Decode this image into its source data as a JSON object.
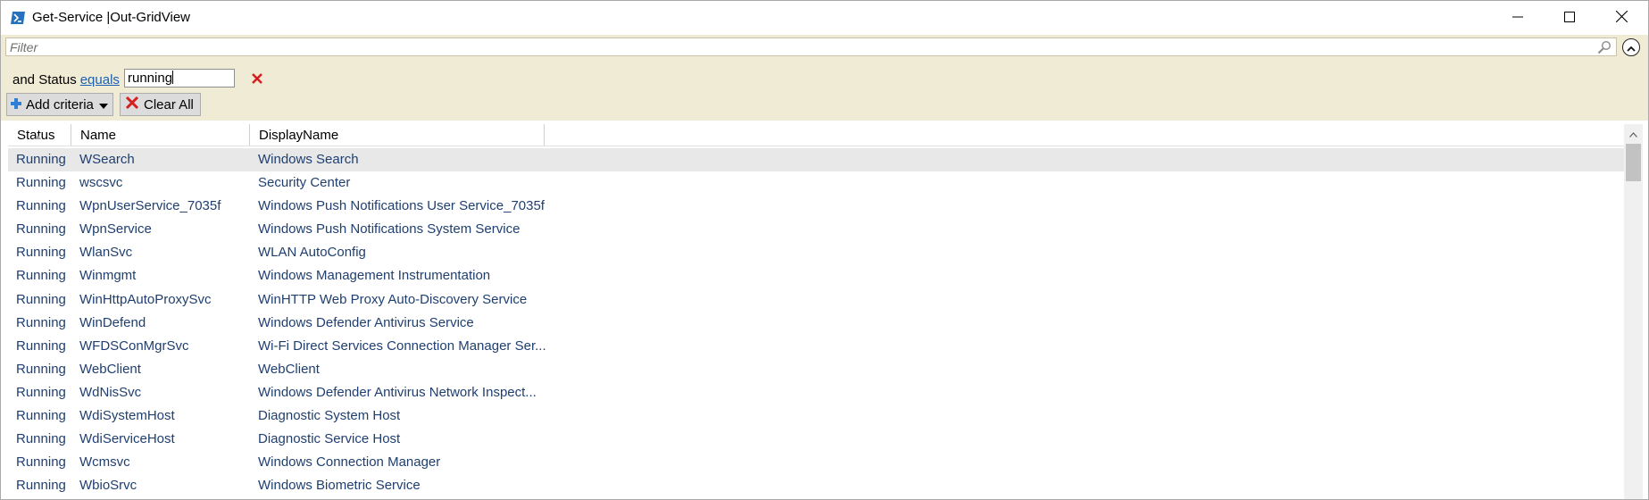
{
  "window": {
    "title": "Get-Service |Out-GridView",
    "icon": "powershell-icon"
  },
  "filter": {
    "placeholder": "Filter",
    "value": ""
  },
  "criteria": {
    "prefix": "and Status",
    "operator": "equals",
    "value": "running"
  },
  "toolbar": {
    "add_criteria_label": "Add criteria",
    "clear_all_label": "Clear All"
  },
  "grid": {
    "columns": [
      "Status",
      "Name",
      "DisplayName"
    ],
    "sort_column": "Status",
    "rows": [
      {
        "status": "Running",
        "name": "WSearch",
        "display": "Windows Search"
      },
      {
        "status": "Running",
        "name": "wscsvc",
        "display": "Security Center"
      },
      {
        "status": "Running",
        "name": "WpnUserService_7035f",
        "display": "Windows Push Notifications User Service_7035f"
      },
      {
        "status": "Running",
        "name": "WpnService",
        "display": "Windows Push Notifications System Service"
      },
      {
        "status": "Running",
        "name": "WlanSvc",
        "display": "WLAN AutoConfig"
      },
      {
        "status": "Running",
        "name": "Winmgmt",
        "display": "Windows Management Instrumentation"
      },
      {
        "status": "Running",
        "name": "WinHttpAutoProxySvc",
        "display": "WinHTTP Web Proxy Auto-Discovery Service"
      },
      {
        "status": "Running",
        "name": "WinDefend",
        "display": "Windows Defender Antivirus Service"
      },
      {
        "status": "Running",
        "name": "WFDSConMgrSvc",
        "display": "Wi-Fi Direct Services Connection Manager Ser..."
      },
      {
        "status": "Running",
        "name": "WebClient",
        "display": "WebClient"
      },
      {
        "status": "Running",
        "name": "WdNisSvc",
        "display": "Windows Defender Antivirus Network Inspect..."
      },
      {
        "status": "Running",
        "name": "WdiSystemHost",
        "display": "Diagnostic System Host"
      },
      {
        "status": "Running",
        "name": "WdiServiceHost",
        "display": "Diagnostic Service Host"
      },
      {
        "status": "Running",
        "name": "Wcmsvc",
        "display": "Windows Connection Manager"
      },
      {
        "status": "Running",
        "name": "WbioSrvc",
        "display": "Windows Biometric Service"
      }
    ]
  },
  "colors": {
    "filter_background": "#f0ebd5",
    "row_text": "#1f3f70",
    "link": "#1a5fb4",
    "remove_red": "#d42020",
    "add_blue": "#2f7fd6"
  }
}
